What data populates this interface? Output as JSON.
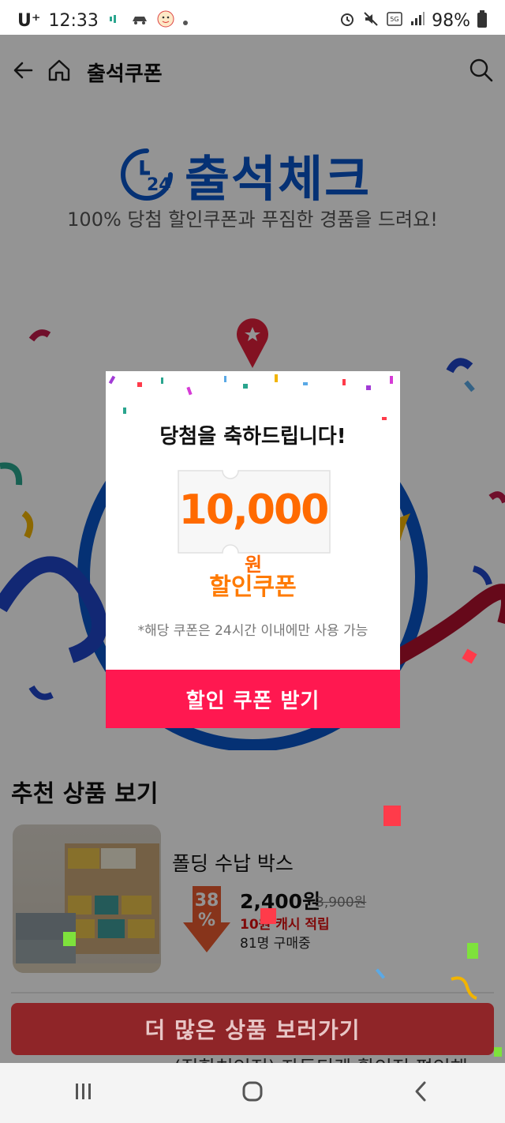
{
  "status_bar": {
    "carrier": "U⁺",
    "time": "12:33",
    "battery": "98%",
    "icons": [
      "cloud-icon",
      "car-icon",
      "avatar-icon",
      "dot-icon",
      "alarm-icon",
      "mute-icon",
      "5g-icon",
      "signal-icon",
      "battery-icon"
    ]
  },
  "header": {
    "title": "출석쿠폰",
    "back_icon": "back-arrow-icon",
    "home_icon": "home-icon",
    "search_icon": "search-icon"
  },
  "hero": {
    "logo_badge": "24",
    "logo_text": "출석체크",
    "subtitle": "100% 당첨 할인쿠폰과 푸짐한 경품을 드려요!"
  },
  "modal": {
    "title": "당첨을 축하드립니다!",
    "coupon_amount": "10,000",
    "coupon_unit": "원",
    "coupon_label": "할인쿠폰",
    "note": "*해당 쿠폰은 24시간 이내에만 사용 가능",
    "button": "할인 쿠폰 받기"
  },
  "recommend": {
    "title": "추천 상품 보기",
    "products": [
      {
        "name": "폴딩 수납 박스",
        "discount": "38",
        "discount_unit": "%",
        "price": "2,400원",
        "original_price": "3,900원",
        "points": "10원 캐시 적립",
        "buyers": "81명 구매중"
      }
    ],
    "next_item_partial": "(직학처인정) 자동티켓 활인정 편인해"
  },
  "cta": {
    "label": "더 많은 상품 보러가기"
  },
  "navbar": {
    "icons": [
      "recent-apps-icon",
      "home-circle-icon",
      "back-chevron-icon"
    ]
  },
  "colors": {
    "brand_blue": "#0a55c9",
    "coupon_orange": "#ff6a00",
    "modal_button": "#ff1850",
    "cta_red": "#e8373b"
  }
}
